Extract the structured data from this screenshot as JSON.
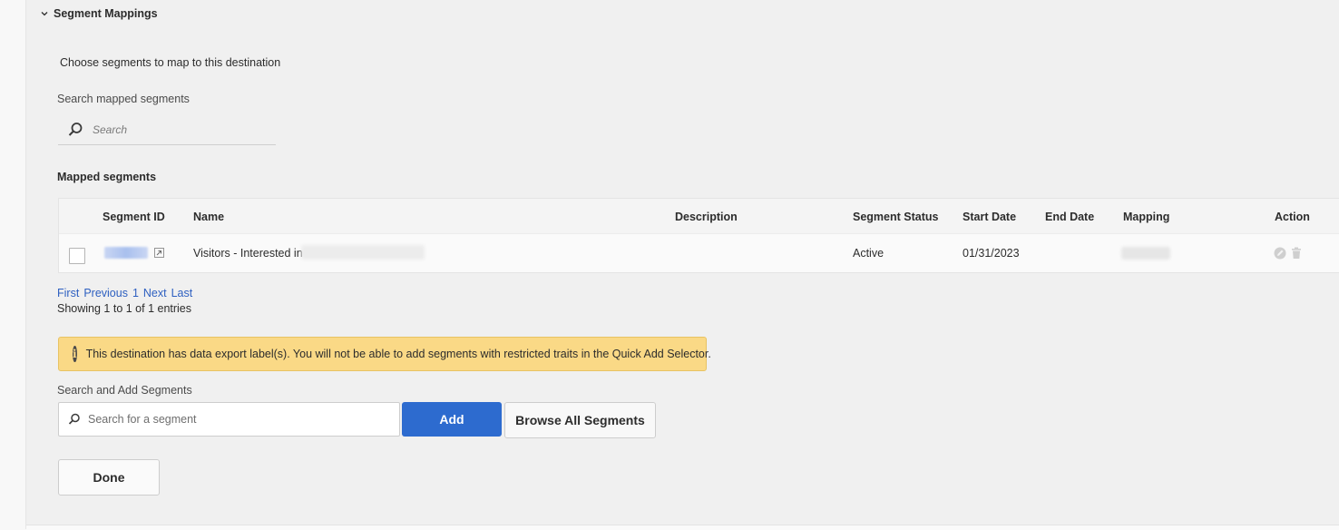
{
  "section": {
    "title": "Segment Mappings",
    "icon": "chevron-down-icon"
  },
  "intro": "Choose segments to map to this destination",
  "search_mapped": {
    "label": "Search mapped segments",
    "placeholder": "Search",
    "icon": "search-icon"
  },
  "mapped_heading": "Mapped segments",
  "table": {
    "columns": [
      "Segment ID",
      "Name",
      "Description",
      "Segment Status",
      "Start Date",
      "End Date",
      "Mapping",
      "Action"
    ],
    "rows": [
      {
        "segment_id": "",
        "name": "Visitors - Interested in -",
        "description": "",
        "status": "Active",
        "start_date": "01/31/2023",
        "end_date": "",
        "mapping": "",
        "actions": [
          "edit-icon",
          "trash-icon"
        ]
      }
    ]
  },
  "pagination": {
    "first": "First",
    "previous": "Previous",
    "page": "1",
    "next": "Next",
    "last": "Last",
    "summary": "Showing 1 to 1 of 1 entries"
  },
  "alert": {
    "icon": "info-icon",
    "message": "This destination has data export label(s). You will not be able to add segments with restricted traits in the Quick Add Selector."
  },
  "add_segments": {
    "label": "Search and Add Segments",
    "placeholder": "Search for a segment",
    "add_button": "Add",
    "browse_button": "Browse All Segments"
  },
  "done_button": "Done",
  "colors": {
    "primary": "#2d6bcf",
    "link": "#2d5fc0",
    "alert_bg": "#fad986",
    "panel_bg": "#f0f0f0"
  }
}
